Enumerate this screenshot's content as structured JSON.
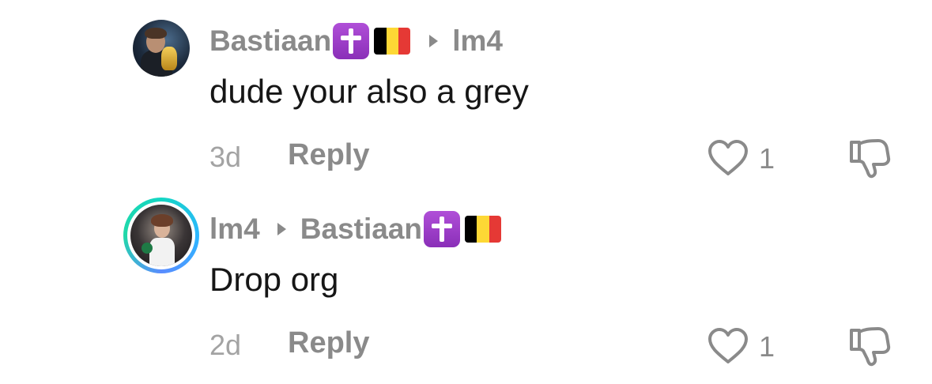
{
  "comments": [
    {
      "author": "Bastiaan",
      "author_badge": "cross-badge",
      "author_flag": "belgium-flag",
      "reply_to": "lm4",
      "text": "dude your also a grey",
      "time": "3d",
      "reply_label": "Reply",
      "like_count": "1",
      "avatar_story_ring": false
    },
    {
      "author": "lm4",
      "reply_to": "Bastiaan",
      "reply_to_badge": "cross-badge",
      "reply_to_flag": "belgium-flag",
      "text": "Drop org",
      "time": "2d",
      "reply_label": "Reply",
      "like_count": "1",
      "avatar_story_ring": true
    }
  ],
  "colors": {
    "username_gray": "#8a8a8a",
    "meta_gray": "#a3a3a3",
    "text": "#161616",
    "badge_purple": "#9b3ec9",
    "flag_black": "#000000",
    "flag_yellow": "#fdd835",
    "flag_red": "#e53935",
    "ring_gradient_start": "#13d6c3",
    "ring_gradient_end": "#2bb6ff"
  },
  "icons": {
    "like": "heart-outline-icon",
    "dislike": "thumbs-down-outline-icon",
    "reply_arrow": "triangle-right-icon"
  }
}
